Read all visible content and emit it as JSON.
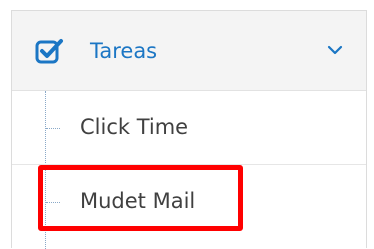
{
  "menu": {
    "header": {
      "label": "Tareas",
      "icon": "checkbox-icon",
      "expand_icon": "chevron-down-icon",
      "accent_color": "#1b76c4"
    },
    "items": [
      {
        "label": "Click Time"
      },
      {
        "label": "Mudet Mail"
      }
    ]
  },
  "annotation": {
    "highlight_color": "#ff0000",
    "highlighted_item": "Mudet Mail"
  }
}
